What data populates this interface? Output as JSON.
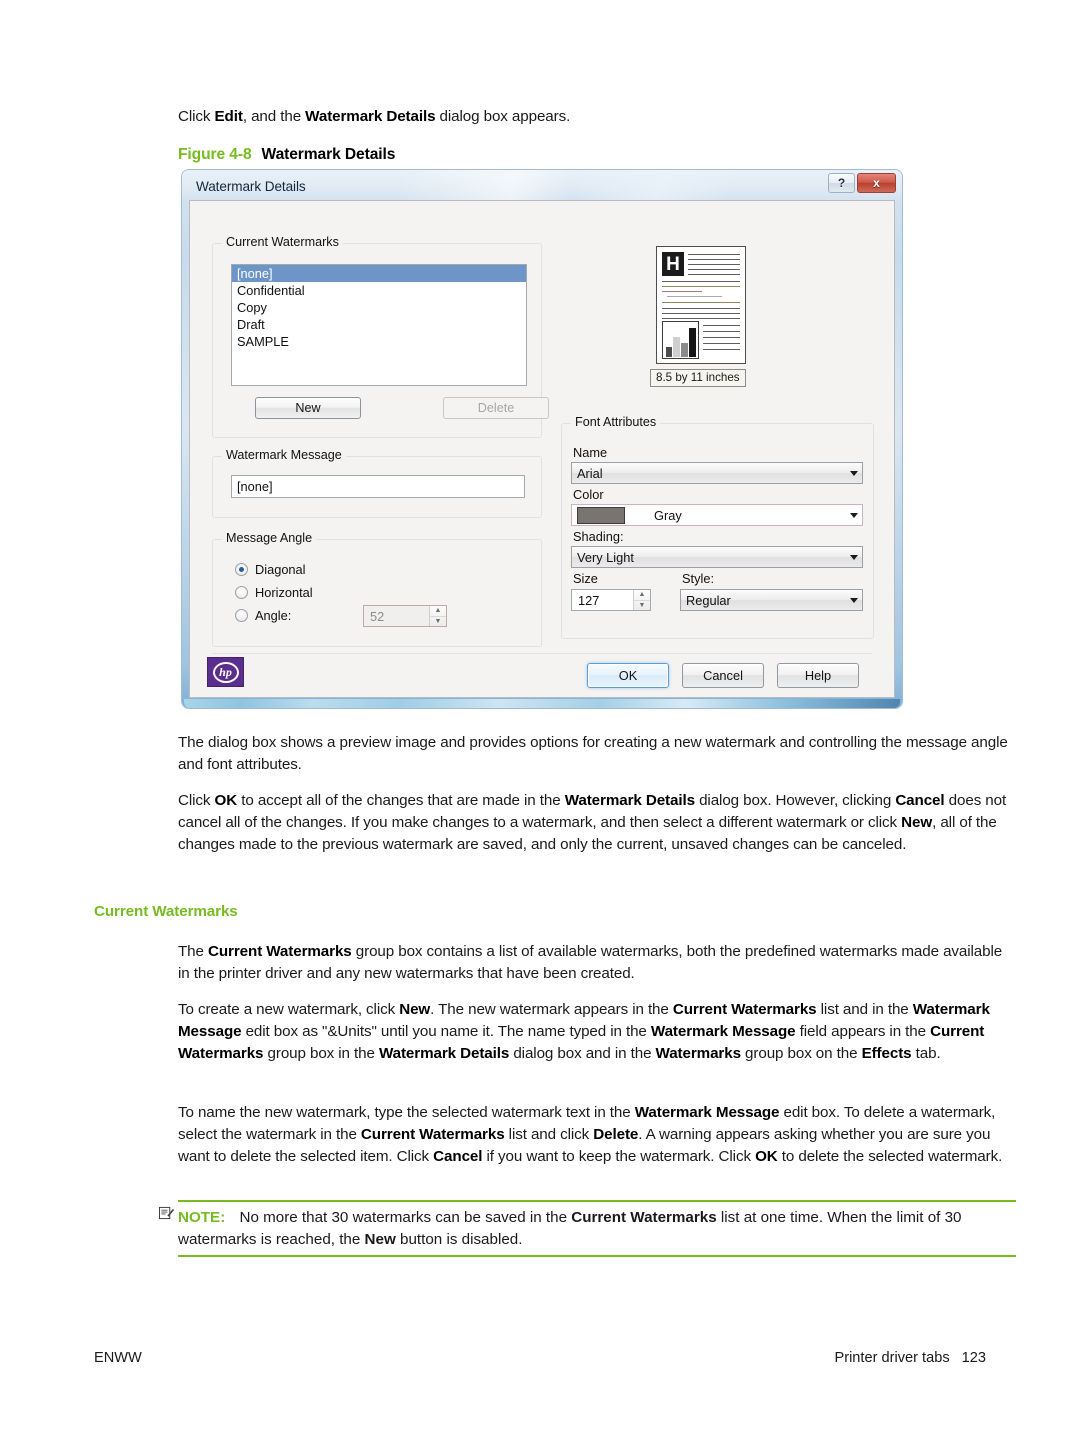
{
  "document": {
    "intro_line": {
      "prefix": "Click ",
      "bold1": "Edit",
      "mid": ", and the ",
      "bold2": "Watermark Details",
      "suffix": " dialog box appears."
    },
    "figure_caption": {
      "number": "Figure 4-8",
      "title": "Watermark Details"
    },
    "paragraph_1": "The dialog box shows a preview image and provides options for creating a new watermark and controlling the message angle and font attributes.",
    "paragraph_2": {
      "t1": "Click ",
      "b1": "OK",
      "t2": " to accept all of the changes that are made in the ",
      "b2": "Watermark Details",
      "t3": " dialog box. However, clicking ",
      "b3": "Cancel",
      "t4": " does not cancel all of the changes. If you make changes to a watermark, and then select a different watermark or click ",
      "b4": "New",
      "t5": ", all of the changes made to the previous watermark are saved, and only the current, unsaved changes can be canceled."
    },
    "section_heading": "Current Watermarks",
    "paragraph_3": {
      "t1": "The ",
      "b1": "Current Watermarks",
      "t2": " group box contains a list of available watermarks, both the predefined watermarks made available in the printer driver and any new watermarks that have been created."
    },
    "paragraph_4": {
      "t1": "To create a new watermark, click ",
      "b1": "New",
      "t2": ". The new watermark appears in the ",
      "b2": "Current Watermarks",
      "t3": " list and in the ",
      "b3": "Watermark Message",
      "t4": " edit box as \"&Units\" until you name it. The name typed in the ",
      "b4": "Watermark Message",
      "t5": " field appears in the ",
      "b5": "Current Watermarks",
      "t6": " group box in the ",
      "b6": "Watermark Details",
      "t7": " dialog box and in the ",
      "b7": "Watermarks",
      "t8": " group box on the ",
      "b8": "Effects",
      "t9": " tab."
    },
    "paragraph_5": {
      "t1": "To name the new watermark, type the selected watermark text in the ",
      "b1": "Watermark Message",
      "t2": " edit box. To delete a watermark, select the watermark in the ",
      "b2": "Current Watermarks",
      "t3": " list and click ",
      "b3": "Delete",
      "t4": ". A warning appears asking whether you are sure you want to delete the selected item. Click ",
      "b4": "Cancel",
      "t5": " if you want to keep the watermark. Click ",
      "b5": "OK",
      "t6": " to delete the selected watermark."
    },
    "note": {
      "label": "NOTE:",
      "t1": " No more that 30 watermarks can be saved in the ",
      "b1": "Current Watermarks",
      "t2": " list at one time. When the limit of 30 watermarks is reached, the ",
      "b2": "New",
      "t3": " button is disabled."
    },
    "footer": {
      "left": "ENWW",
      "right": "Printer driver tabs",
      "page_number": "123"
    }
  },
  "dialog": {
    "title": "Watermark Details",
    "titlebar_buttons": {
      "help": "?",
      "close": "x"
    },
    "current_watermarks": {
      "legend": "Current Watermarks",
      "items": [
        {
          "label": "[none]",
          "selected": true
        },
        {
          "label": "Confidential",
          "selected": false
        },
        {
          "label": "Copy",
          "selected": false
        },
        {
          "label": "Draft",
          "selected": false
        },
        {
          "label": "SAMPLE",
          "selected": false
        }
      ],
      "new_button": "New",
      "delete_button": "Delete",
      "delete_disabled": true
    },
    "watermark_message": {
      "legend": "Watermark Message",
      "value": "[none]"
    },
    "message_angle": {
      "legend": "Message Angle",
      "options": [
        {
          "label": "Diagonal",
          "checked": true
        },
        {
          "label": "Horizontal",
          "checked": false
        },
        {
          "label": "Angle:",
          "checked": false
        }
      ],
      "angle_value": "52",
      "angle_disabled": true
    },
    "preview": {
      "logo_letter": "H",
      "caption": "8.5 by 11 inches"
    },
    "font_attributes": {
      "legend": "Font Attributes",
      "name_label": "Name",
      "name_value": "Arial",
      "color_label": "Color",
      "color_value": "Gray",
      "color_swatch_hex": "#787470",
      "shading_label": "Shading:",
      "shading_value": "Very Light",
      "size_label": "Size",
      "size_value": "127",
      "style_label": "Style:",
      "style_value": "Regular"
    },
    "actions": {
      "ok": "OK",
      "cancel": "Cancel",
      "help": "Help"
    },
    "brand_logo": "hp"
  },
  "theme": {
    "accent_green": "#76bc21",
    "selection_blue": "#6e95c8",
    "hp_purple": "#5b2d8e"
  }
}
